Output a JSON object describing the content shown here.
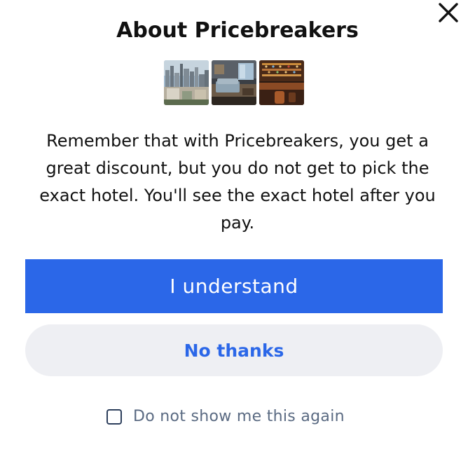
{
  "dialog": {
    "title": "About Pricebreakers",
    "message": "Remember that with Pricebreakers, you get a great discount, but you do not get to pick the exact hotel. You'll see the exact hotel after you pay.",
    "close_icon": "close-icon",
    "thumbnails": [
      {
        "icon": "city-skyline-photo"
      },
      {
        "icon": "hotel-room-photo"
      },
      {
        "icon": "hotel-bar-photo"
      }
    ]
  },
  "actions": {
    "primary_label": "I understand",
    "secondary_label": "No thanks"
  },
  "preferences": {
    "dont_show_label": "Do not show me this again",
    "dont_show_checked": false
  },
  "colors": {
    "primary": "#2b67e8",
    "secondary_bg": "#eeeff3",
    "text": "#111111",
    "muted_text": "#5a6a82"
  }
}
